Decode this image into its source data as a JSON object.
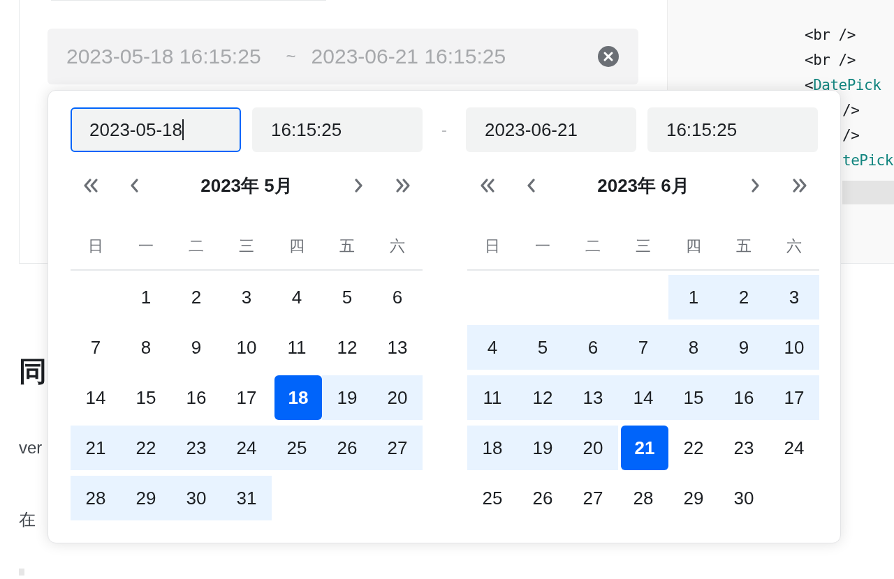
{
  "range_input": {
    "start": "2023-05-18 16:15:25",
    "separator": "~",
    "end": "2023-06-21 16:15:25"
  },
  "popup": {
    "fields": [
      {
        "kind": "date",
        "value": "2023-05-18",
        "focused": true
      },
      {
        "kind": "time",
        "value": "16:15:25",
        "focused": false
      },
      {
        "kind": "separator",
        "value": "-"
      },
      {
        "kind": "date",
        "value": "2023-06-21",
        "focused": false
      },
      {
        "kind": "time",
        "value": "16:15:25",
        "focused": false
      }
    ],
    "calendars": [
      {
        "title": "2023年 5月",
        "weekdays": [
          "日",
          "一",
          "二",
          "三",
          "四",
          "五",
          "六"
        ],
        "days": [
          {
            "kind": "blank"
          },
          {
            "kind": "day",
            "day": "1",
            "in_range": false,
            "selected": false
          },
          {
            "kind": "day",
            "day": "2",
            "in_range": false,
            "selected": false
          },
          {
            "kind": "day",
            "day": "3",
            "in_range": false,
            "selected": false
          },
          {
            "kind": "day",
            "day": "4",
            "in_range": false,
            "selected": false
          },
          {
            "kind": "day",
            "day": "5",
            "in_range": false,
            "selected": false
          },
          {
            "kind": "day",
            "day": "6",
            "in_range": false,
            "selected": false
          },
          {
            "kind": "day",
            "day": "7",
            "in_range": false,
            "selected": false
          },
          {
            "kind": "day",
            "day": "8",
            "in_range": false,
            "selected": false
          },
          {
            "kind": "day",
            "day": "9",
            "in_range": false,
            "selected": false
          },
          {
            "kind": "day",
            "day": "10",
            "in_range": false,
            "selected": false
          },
          {
            "kind": "day",
            "day": "11",
            "in_range": false,
            "selected": false
          },
          {
            "kind": "day",
            "day": "12",
            "in_range": false,
            "selected": false
          },
          {
            "kind": "day",
            "day": "13",
            "in_range": false,
            "selected": false
          },
          {
            "kind": "day",
            "day": "14",
            "in_range": false,
            "selected": false
          },
          {
            "kind": "day",
            "day": "15",
            "in_range": false,
            "selected": false
          },
          {
            "kind": "day",
            "day": "16",
            "in_range": false,
            "selected": false
          },
          {
            "kind": "day",
            "day": "17",
            "in_range": false,
            "selected": false
          },
          {
            "kind": "day",
            "day": "18",
            "in_range": true,
            "selected": true
          },
          {
            "kind": "day",
            "day": "19",
            "in_range": true,
            "selected": false
          },
          {
            "kind": "day",
            "day": "20",
            "in_range": true,
            "selected": false
          },
          {
            "kind": "day",
            "day": "21",
            "in_range": true,
            "selected": false
          },
          {
            "kind": "day",
            "day": "22",
            "in_range": true,
            "selected": false
          },
          {
            "kind": "day",
            "day": "23",
            "in_range": true,
            "selected": false
          },
          {
            "kind": "day",
            "day": "24",
            "in_range": true,
            "selected": false
          },
          {
            "kind": "day",
            "day": "25",
            "in_range": true,
            "selected": false
          },
          {
            "kind": "day",
            "day": "26",
            "in_range": true,
            "selected": false
          },
          {
            "kind": "day",
            "day": "27",
            "in_range": true,
            "selected": false
          },
          {
            "kind": "day",
            "day": "28",
            "in_range": true,
            "selected": false
          },
          {
            "kind": "day",
            "day": "29",
            "in_range": true,
            "selected": false
          },
          {
            "kind": "day",
            "day": "30",
            "in_range": true,
            "selected": false
          },
          {
            "kind": "day",
            "day": "31",
            "in_range": true,
            "selected": false
          }
        ]
      },
      {
        "title": "2023年 6月",
        "weekdays": [
          "日",
          "一",
          "二",
          "三",
          "四",
          "五",
          "六"
        ],
        "days": [
          {
            "kind": "blank"
          },
          {
            "kind": "blank"
          },
          {
            "kind": "blank"
          },
          {
            "kind": "blank"
          },
          {
            "kind": "day",
            "day": "1",
            "in_range": true,
            "selected": false
          },
          {
            "kind": "day",
            "day": "2",
            "in_range": true,
            "selected": false
          },
          {
            "kind": "day",
            "day": "3",
            "in_range": true,
            "selected": false
          },
          {
            "kind": "day",
            "day": "4",
            "in_range": true,
            "selected": false
          },
          {
            "kind": "day",
            "day": "5",
            "in_range": true,
            "selected": false
          },
          {
            "kind": "day",
            "day": "6",
            "in_range": true,
            "selected": false
          },
          {
            "kind": "day",
            "day": "7",
            "in_range": true,
            "selected": false
          },
          {
            "kind": "day",
            "day": "8",
            "in_range": true,
            "selected": false
          },
          {
            "kind": "day",
            "day": "9",
            "in_range": true,
            "selected": false
          },
          {
            "kind": "day",
            "day": "10",
            "in_range": true,
            "selected": false
          },
          {
            "kind": "day",
            "day": "11",
            "in_range": true,
            "selected": false
          },
          {
            "kind": "day",
            "day": "12",
            "in_range": true,
            "selected": false
          },
          {
            "kind": "day",
            "day": "13",
            "in_range": true,
            "selected": false
          },
          {
            "kind": "day",
            "day": "14",
            "in_range": true,
            "selected": false
          },
          {
            "kind": "day",
            "day": "15",
            "in_range": true,
            "selected": false
          },
          {
            "kind": "day",
            "day": "16",
            "in_range": true,
            "selected": false
          },
          {
            "kind": "day",
            "day": "17",
            "in_range": true,
            "selected": false
          },
          {
            "kind": "day",
            "day": "18",
            "in_range": true,
            "selected": false
          },
          {
            "kind": "day",
            "day": "19",
            "in_range": true,
            "selected": false
          },
          {
            "kind": "day",
            "day": "20",
            "in_range": true,
            "selected": false
          },
          {
            "kind": "day",
            "day": "21",
            "in_range": true,
            "selected": true
          },
          {
            "kind": "day",
            "day": "22",
            "in_range": false,
            "selected": false
          },
          {
            "kind": "day",
            "day": "23",
            "in_range": false,
            "selected": false
          },
          {
            "kind": "day",
            "day": "24",
            "in_range": false,
            "selected": false
          },
          {
            "kind": "day",
            "day": "25",
            "in_range": false,
            "selected": false
          },
          {
            "kind": "day",
            "day": "26",
            "in_range": false,
            "selected": false
          },
          {
            "kind": "day",
            "day": "27",
            "in_range": false,
            "selected": false
          },
          {
            "kind": "day",
            "day": "28",
            "in_range": false,
            "selected": false
          },
          {
            "kind": "day",
            "day": "29",
            "in_range": false,
            "selected": false
          },
          {
            "kind": "day",
            "day": "30",
            "in_range": false,
            "selected": false
          }
        ]
      }
    ]
  },
  "code_lines": [
    {
      "tokens": [
        {
          "kind": "punct",
          "text": "<br />"
        }
      ]
    },
    {
      "tokens": [
        {
          "kind": "punct",
          "text": "<br />"
        }
      ]
    },
    {
      "tokens": [
        {
          "kind": "punct",
          "text": "<"
        },
        {
          "kind": "component",
          "text": "DatePick"
        }
      ]
    },
    {
      "tokens": [
        {
          "kind": "punct",
          "text": "/>"
        }
      ]
    },
    {
      "tokens": [
        {
          "kind": "punct",
          "text": "/>"
        }
      ]
    },
    {
      "tokens": [
        {
          "kind": "component",
          "text": "tePick"
        }
      ]
    }
  ],
  "article": {
    "heading": "同",
    "paragraphs": [
      "ver",
      "在"
    ]
  }
}
